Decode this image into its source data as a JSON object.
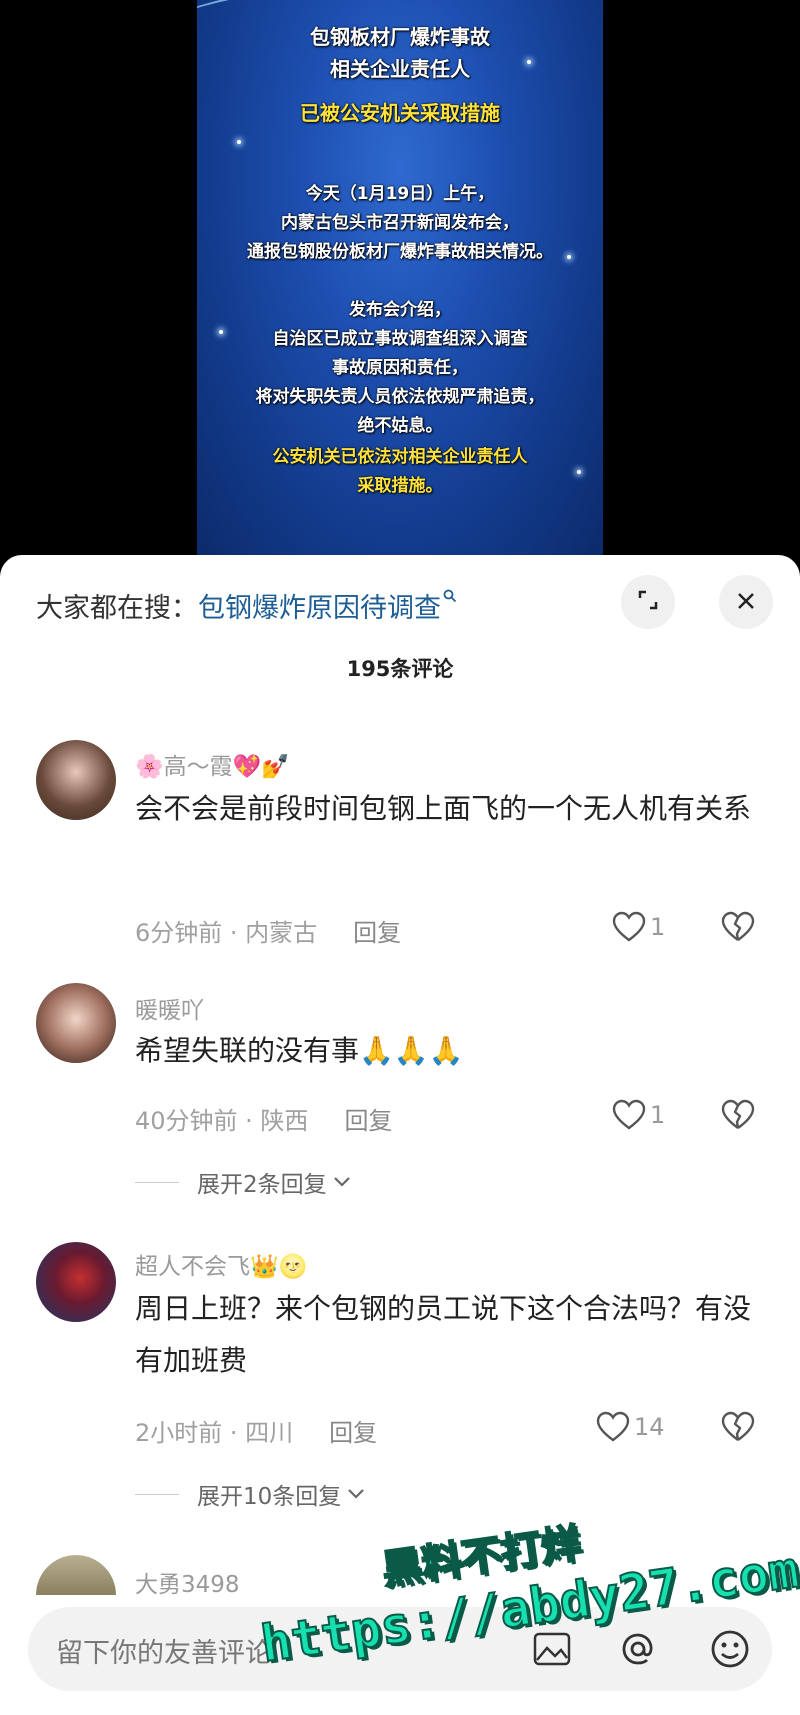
{
  "video": {
    "lines": [
      {
        "text": "包钢板材厂爆炸事故",
        "style": "title"
      },
      {
        "text": "相关企业责任人",
        "style": "title"
      },
      {
        "text": "已被公安机关采取措施",
        "style": "title-yellow"
      },
      {
        "text": "今天（1月19日）上午，",
        "style": "white"
      },
      {
        "text": "内蒙古包头市召开新闻发布会，",
        "style": "white"
      },
      {
        "text": "通报包钢股份板材厂爆炸事故相关情况。",
        "style": "white"
      },
      {
        "text": "发布会介绍，",
        "style": "white"
      },
      {
        "text": "自治区已成立事故调查组深入调查",
        "style": "white"
      },
      {
        "text": "事故原因和责任，",
        "style": "white"
      },
      {
        "text": "将对失职失责人员依法依规严肃追责，",
        "style": "white"
      },
      {
        "text": "绝不姑息。",
        "style": "white"
      },
      {
        "text": "公安机关已依法对相关企业责任人",
        "style": "yellow"
      },
      {
        "text": "采取措施。",
        "style": "yellow"
      }
    ]
  },
  "search": {
    "prefix": "大家都在搜：",
    "term": "包钢爆炸原因待调查"
  },
  "comments_header": {
    "count_label": "195条评论"
  },
  "comments": [
    {
      "username": "🌸高～霞💖💅",
      "text": "会不会是前段时间包钢上面飞的一个无人机有关系",
      "time": "6分钟前 · 内蒙古",
      "reply": "回复",
      "likes": "1"
    },
    {
      "username": "暖暖吖",
      "text": "希望失联的没有事🙏🙏🙏",
      "time": "40分钟前 · 陕西",
      "reply": "回复",
      "likes": "1",
      "expand": "展开2条回复"
    },
    {
      "username": "超人不会飞👑🌝",
      "text": "周日上班？来个包钢的员工说下这个合法吗？有没有加班费",
      "time": "2小时前 · 四川",
      "reply": "回复",
      "likes": "14",
      "expand": "展开10条回复"
    },
    {
      "username": "大勇3498"
    }
  ],
  "input": {
    "placeholder": "留下你的友善评论"
  },
  "watermark": {
    "line1": "黑料不打烊",
    "line2": "https://abdy27.com"
  },
  "colors": {
    "search_term": "#1f5d95",
    "watermark": "#16e0b0"
  }
}
